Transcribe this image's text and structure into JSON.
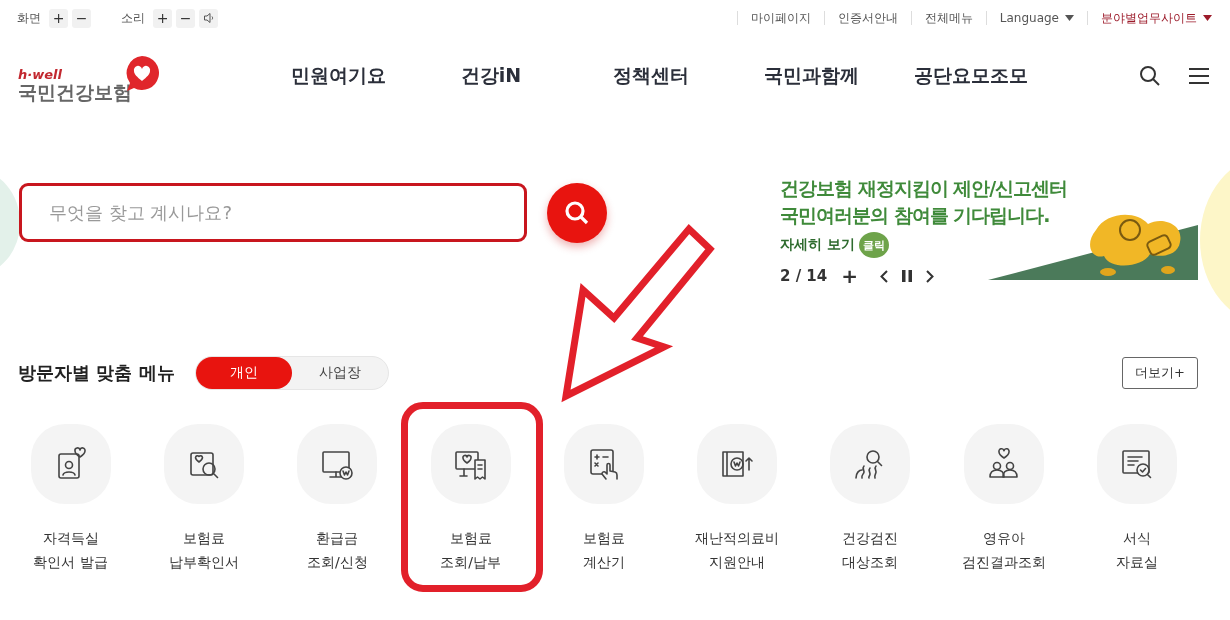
{
  "utility_bar": {
    "screen_label": "화면",
    "sound_label": "소리",
    "zoom_in": "+",
    "zoom_out": "−",
    "links": [
      {
        "label": "마이페이지",
        "dropdown": false,
        "emphasized": false
      },
      {
        "label": "인증서안내",
        "dropdown": false,
        "emphasized": false
      },
      {
        "label": "전체메뉴",
        "dropdown": false,
        "emphasized": false
      },
      {
        "label": "Language",
        "dropdown": true,
        "emphasized": false
      },
      {
        "label": "분야별업무사이트",
        "dropdown": true,
        "emphasized": true
      }
    ]
  },
  "logo": {
    "tagline": "h·well",
    "name": "국민건강보험"
  },
  "nav": [
    "민원여기요",
    "건강iN",
    "정책센터",
    "국민과함께",
    "공단요모조모"
  ],
  "search": {
    "placeholder": "무엇을 찾고 계시나요?"
  },
  "banner": {
    "lines": [
      "건강보험 재정지킴이 제안/신고센터",
      "국민여러분의 참여를 기다립니다."
    ],
    "more": "자세히 보기",
    "badge": "클릭",
    "counter": "2 / 14",
    "add": "+"
  },
  "visitor_menu": {
    "title": "방문자별 맞춤 메뉴",
    "tabs": [
      {
        "label": "개인",
        "selected": true
      },
      {
        "label": "사업장",
        "selected": false
      }
    ],
    "more_button": "더보기+",
    "items": [
      {
        "lines": [
          "자격득실",
          "확인서 발급"
        ],
        "highlighted": false
      },
      {
        "lines": [
          "보험료",
          "납부확인서"
        ],
        "highlighted": false
      },
      {
        "lines": [
          "환급금",
          "조회/신청"
        ],
        "highlighted": false
      },
      {
        "lines": [
          "보험료",
          "조회/납부"
        ],
        "highlighted": true
      },
      {
        "lines": [
          "보험료",
          "계산기"
        ],
        "highlighted": false
      },
      {
        "lines": [
          "재난적의료비",
          "지원안내"
        ],
        "highlighted": false
      },
      {
        "lines": [
          "건강검진",
          "대상조회"
        ],
        "highlighted": false
      },
      {
        "lines": [
          "영유아",
          "검진결과조회"
        ],
        "highlighted": false
      },
      {
        "lines": [
          "서식",
          "자료실"
        ],
        "highlighted": false
      }
    ]
  }
}
